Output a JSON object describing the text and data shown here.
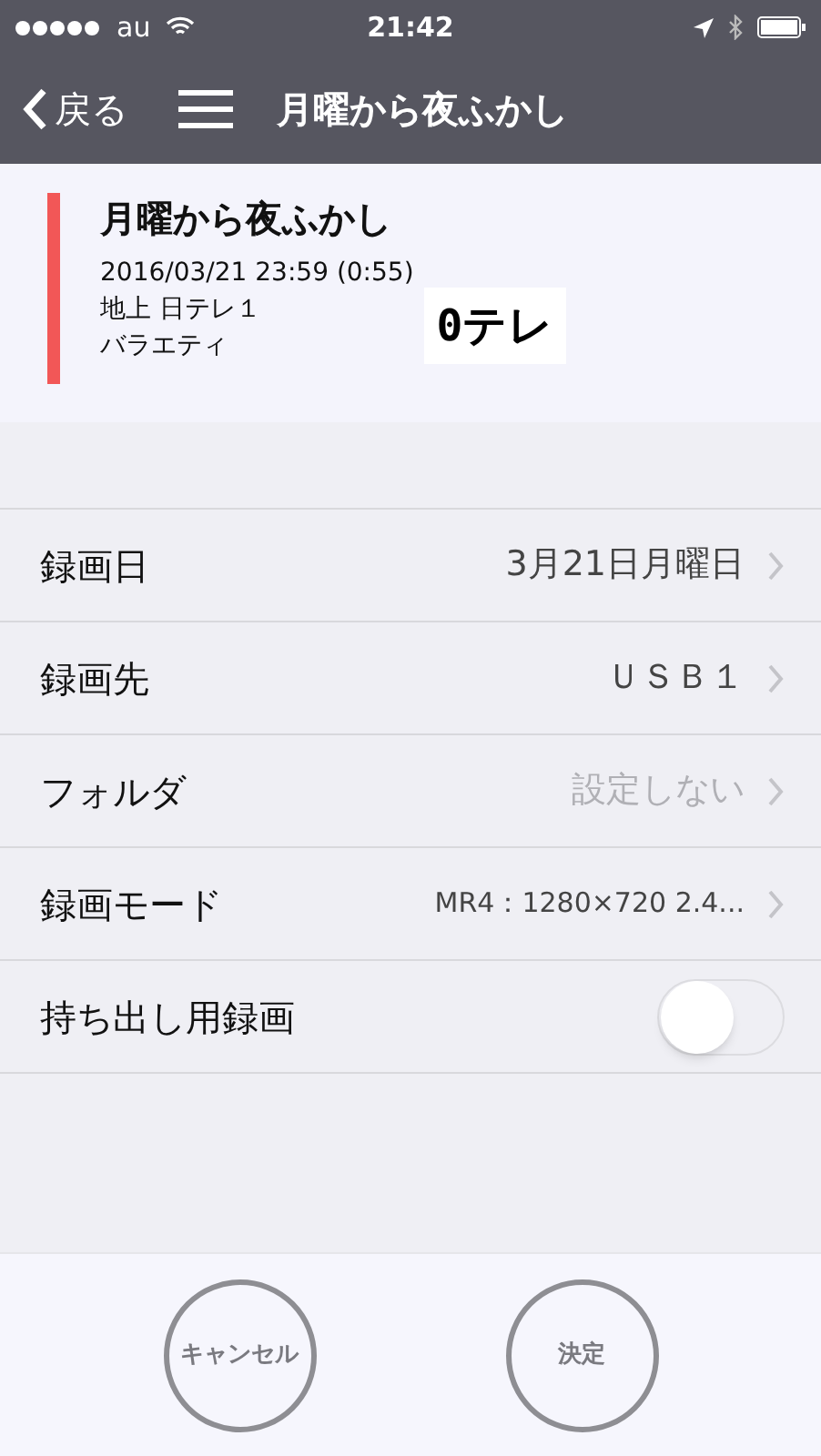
{
  "status_bar": {
    "carrier": "au",
    "time": "21:42"
  },
  "nav": {
    "back": "戻る",
    "title": "月曜から夜ふかし"
  },
  "program": {
    "title": "月曜から夜ふかし",
    "datetime": "2016/03/21 23:59 (0:55)",
    "channel": "地上 日テレ１",
    "genre": "バラエティ",
    "logo_text": "0テレ",
    "color": "#f25757"
  },
  "settings": [
    {
      "kind": "link",
      "label": "録画日",
      "value": "3月21日月曜日",
      "dimmed": false
    },
    {
      "kind": "link",
      "label": "録画先",
      "value": "ＵＳＢ１",
      "dimmed": false
    },
    {
      "kind": "link",
      "label": "フォルダ",
      "value": "設定しない",
      "dimmed": true
    },
    {
      "kind": "link",
      "label": "録画モード",
      "value": "MR4：1280×720 2.4...",
      "dimmed": false,
      "small": true
    },
    {
      "kind": "toggle",
      "label": "持ち出し用録画",
      "on": false
    }
  ],
  "buttons": [
    "キャンセル",
    "決定"
  ]
}
